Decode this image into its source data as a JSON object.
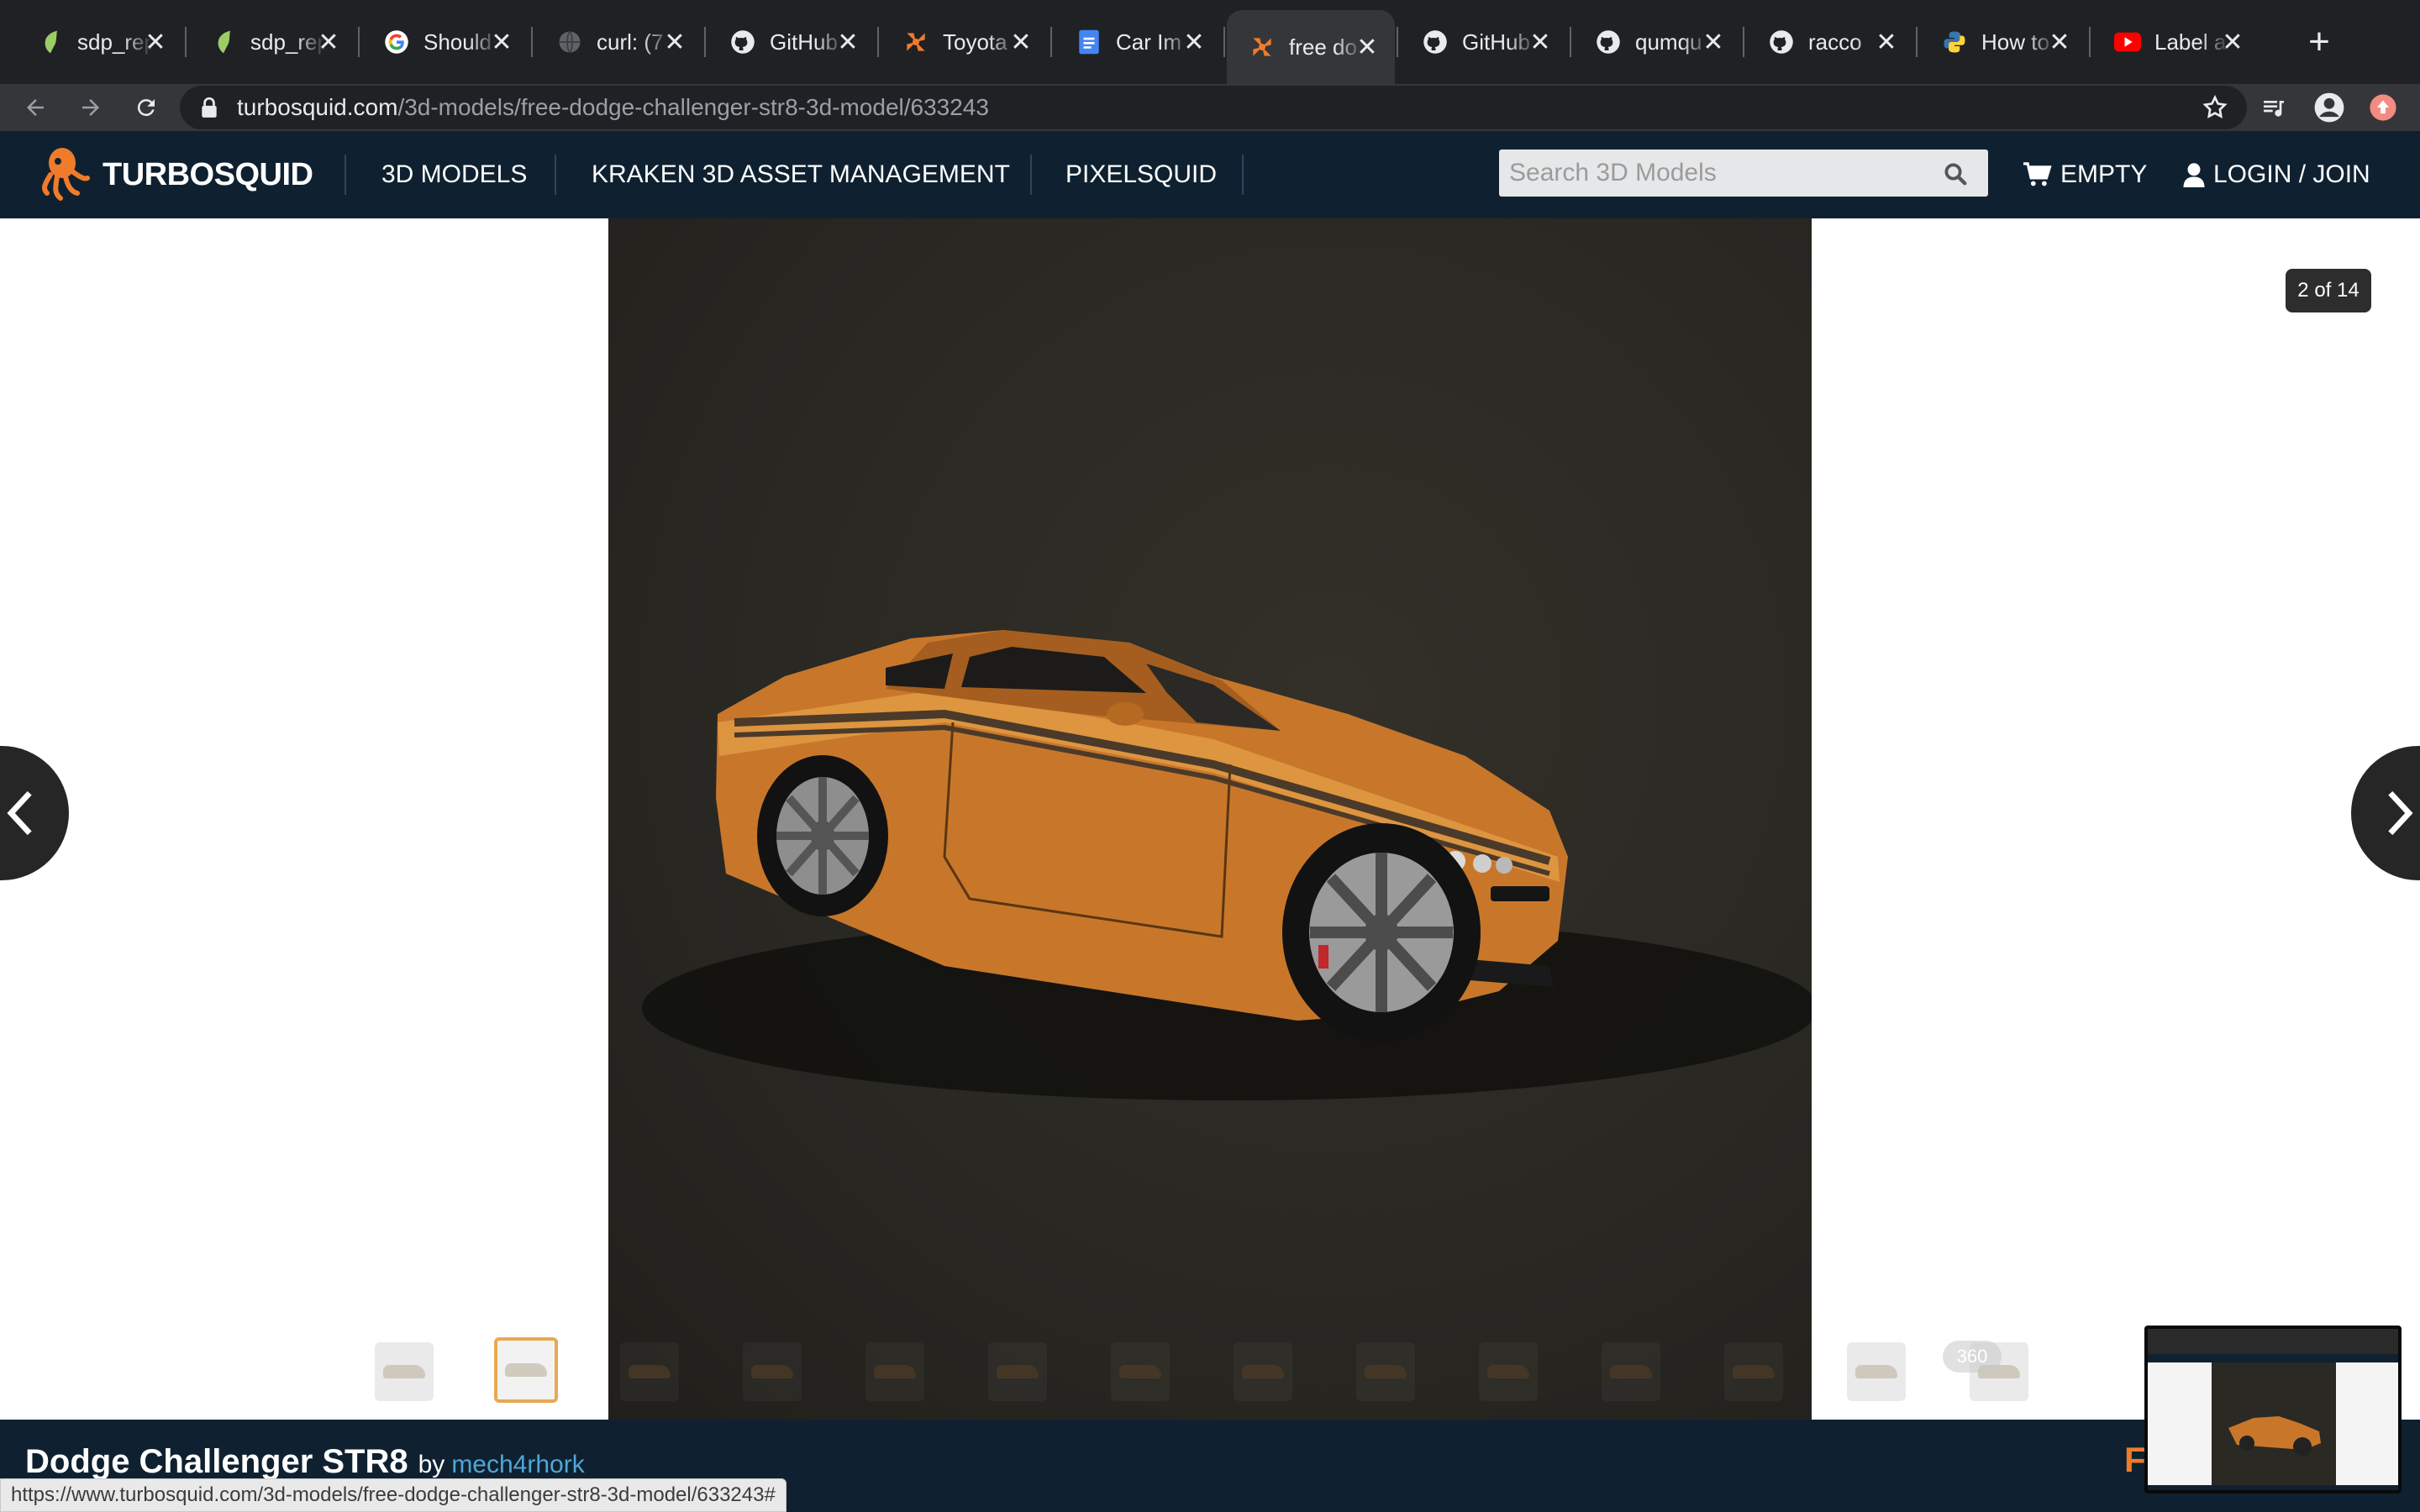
{
  "browser": {
    "tabs": [
      {
        "title": "sdp_repo",
        "favicon": "leaf-icon"
      },
      {
        "title": "sdp_repo",
        "favicon": "leaf-icon"
      },
      {
        "title": "Should",
        "favicon": "google-icon"
      },
      {
        "title": "curl: (7",
        "favicon": "globe-icon"
      },
      {
        "title": "GitHub",
        "favicon": "github-icon"
      },
      {
        "title": "Toyota",
        "favicon": "turbosquid-icon"
      },
      {
        "title": "Car Im",
        "favicon": "docs-icon"
      },
      {
        "title": "free do",
        "favicon": "turbosquid-icon",
        "active": true
      },
      {
        "title": "GitHub",
        "favicon": "github-icon"
      },
      {
        "title": "qumqu",
        "favicon": "github-icon"
      },
      {
        "title": "racco",
        "favicon": "github-icon"
      },
      {
        "title": "How to",
        "favicon": "python-icon"
      },
      {
        "title": "Label a",
        "favicon": "youtube-icon"
      }
    ],
    "close_glyph": "✕",
    "new_tab_glyph": "+",
    "url_domain": "turbosquid.com",
    "url_path": "/3d-models/free-dodge-challenger-str8-3d-model/633243",
    "status_url": "https://www.turbosquid.com/3d-models/free-dodge-challenger-str8-3d-model/633243#"
  },
  "site": {
    "brand": "TURBOSQUID",
    "nav": [
      "3D MODELS",
      "KRAKEN 3D ASSET MANAGEMENT",
      "PIXELSQUID"
    ],
    "search_placeholder": "Search 3D Models",
    "cart_label": "EMPTY",
    "login_label": "LOGIN / JOIN"
  },
  "viewer": {
    "counter": "2 of 14",
    "badge_360": "360",
    "selected_thumb_index": 1,
    "thumb_count": 14
  },
  "product": {
    "title": "Dodge Challenger STR8",
    "by_label": "by",
    "author": "mech4rhork",
    "cta_peek": "F"
  },
  "colors": {
    "site_dark": "#0f2130",
    "accent_orange": "#f07b2b",
    "author_link": "#4fa7d8",
    "selected_thumb_border": "#e8a950",
    "car_body": "#d6862c"
  }
}
